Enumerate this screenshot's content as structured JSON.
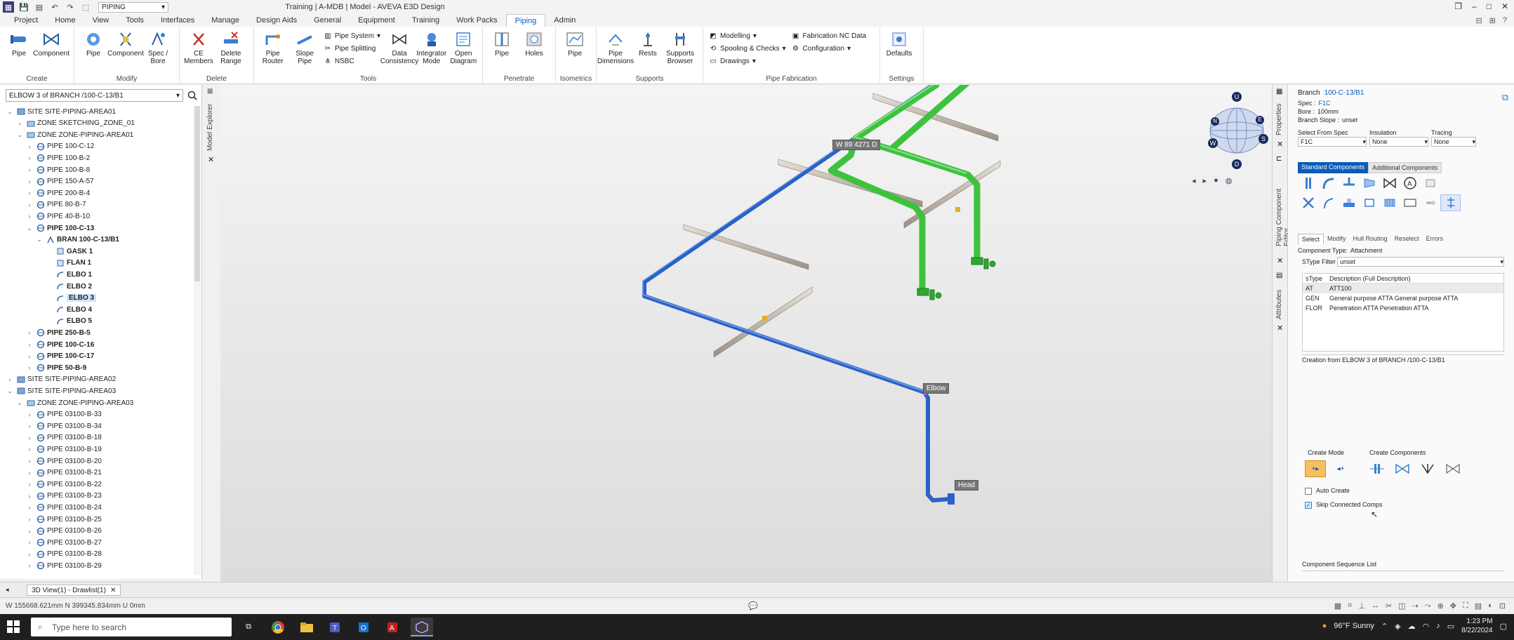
{
  "titlebar": {
    "quick_select": "PIPING",
    "window_title": "Training | A-MDB | Model - AVEVA E3D Design"
  },
  "menu": {
    "tabs": [
      "Project",
      "Home",
      "View",
      "Tools",
      "Interfaces",
      "Manage",
      "Design Aids",
      "General",
      "Equipment",
      "Training",
      "Work Packs",
      "Piping",
      "Admin"
    ],
    "active": "Piping"
  },
  "ribbon": {
    "groups": [
      {
        "label": "Create",
        "buttons": [
          "Pipe",
          "Component"
        ]
      },
      {
        "label": "Modify",
        "buttons": [
          "Pipe",
          "Component",
          "Spec / Bore"
        ]
      },
      {
        "label": "Delete",
        "buttons": [
          "CE Members",
          "Delete Range"
        ]
      },
      {
        "label": "Tools",
        "buttons": [
          "Pipe Router",
          "Slope Pipe",
          "Data Consistency",
          "Integrator Mode",
          "Open Diagram"
        ],
        "small": [
          "Pipe System",
          "Pipe Splitting",
          "NSBC"
        ]
      },
      {
        "label": "Penetrate",
        "buttons": [
          "Pipe",
          "Holes"
        ]
      },
      {
        "label": "Isometrics",
        "buttons": [
          "Pipe"
        ]
      },
      {
        "label": "Supports",
        "buttons": [
          "Pipe Dimensions",
          "Rests",
          "Supports Browser"
        ]
      },
      {
        "label": "Pipe Fabrication",
        "small": [
          "Modelling",
          "Spooling & Checks",
          "Drawings",
          "Fabrication NC Data",
          "Configuration"
        ]
      },
      {
        "label": "Settings",
        "buttons": [
          "Defaults"
        ]
      }
    ]
  },
  "explorer": {
    "side_tab": "Model Explorer",
    "search_value": "ELBOW 3 of BRANCH /100-C-13/B1",
    "tree": [
      {
        "label": "SITE SITE-PIPING-AREA01",
        "level": 1,
        "exp": "⌄",
        "kind": "site"
      },
      {
        "label": "ZONE SKETCHING_ZONE_01",
        "level": 2,
        "exp": "›",
        "kind": "zone"
      },
      {
        "label": "ZONE ZONE-PIPING-AREA01",
        "level": 2,
        "exp": "⌄",
        "kind": "zone"
      },
      {
        "label": "PIPE 100-C-12",
        "level": 3,
        "exp": "›",
        "kind": "pipe"
      },
      {
        "label": "PIPE 100-B-2",
        "level": 3,
        "exp": "›",
        "kind": "pipe"
      },
      {
        "label": "PIPE 100-B-8",
        "level": 3,
        "exp": "›",
        "kind": "pipe"
      },
      {
        "label": "PIPE 150-A-57",
        "level": 3,
        "exp": "›",
        "kind": "pipe"
      },
      {
        "label": "PIPE 200-B-4",
        "level": 3,
        "exp": "›",
        "kind": "pipe"
      },
      {
        "label": "PIPE 80-B-7",
        "level": 3,
        "exp": "›",
        "kind": "pipe"
      },
      {
        "label": "PIPE 40-B-10",
        "level": 3,
        "exp": "›",
        "kind": "pipe"
      },
      {
        "label": "PIPE 100-C-13",
        "level": 3,
        "exp": "⌄",
        "kind": "pipe",
        "bold": true
      },
      {
        "label": "BRAN 100-C-13/B1",
        "level": 4,
        "exp": "⌄",
        "kind": "bran",
        "bold": true
      },
      {
        "label": "GASK 1",
        "level": 5,
        "exp": "",
        "kind": "comp",
        "bold": true
      },
      {
        "label": "FLAN 1",
        "level": 5,
        "exp": "",
        "kind": "comp",
        "bold": true
      },
      {
        "label": "ELBO 1",
        "level": 5,
        "exp": "",
        "kind": "elbo",
        "bold": true
      },
      {
        "label": "ELBO 2",
        "level": 5,
        "exp": "",
        "kind": "elbo",
        "bold": true
      },
      {
        "label": "ELBO 3",
        "level": 5,
        "exp": "",
        "kind": "elbo",
        "bold": true,
        "selected": true
      },
      {
        "label": "ELBO 4",
        "level": 5,
        "exp": "",
        "kind": "elbo",
        "bold": true
      },
      {
        "label": "ELBO 5",
        "level": 5,
        "exp": "",
        "kind": "elbo",
        "bold": true
      },
      {
        "label": "PIPE 250-B-5",
        "level": 3,
        "exp": "›",
        "kind": "pipe",
        "bold": true
      },
      {
        "label": "PIPE 100-C-16",
        "level": 3,
        "exp": "›",
        "kind": "pipe",
        "bold": true
      },
      {
        "label": "PIPE 100-C-17",
        "level": 3,
        "exp": "›",
        "kind": "pipe",
        "bold": true
      },
      {
        "label": "PIPE 50-B-9",
        "level": 3,
        "exp": "›",
        "kind": "pipe",
        "bold": true
      },
      {
        "label": "SITE SITE-PIPING-AREA02",
        "level": 1,
        "exp": "›",
        "kind": "site"
      },
      {
        "label": "SITE SITE-PIPING-AREA03",
        "level": 1,
        "exp": "⌄",
        "kind": "site"
      },
      {
        "label": "ZONE ZONE-PIPING-AREA03",
        "level": 2,
        "exp": "⌄",
        "kind": "zone"
      },
      {
        "label": "PIPE 03100-B-33",
        "level": 3,
        "exp": "›",
        "kind": "pipe"
      },
      {
        "label": "PIPE 03100-B-34",
        "level": 3,
        "exp": "›",
        "kind": "pipe"
      },
      {
        "label": "PIPE 03100-B-18",
        "level": 3,
        "exp": "›",
        "kind": "pipe"
      },
      {
        "label": "PIPE 03100-B-19",
        "level": 3,
        "exp": "›",
        "kind": "pipe"
      },
      {
        "label": "PIPE 03100-B-20",
        "level": 3,
        "exp": "›",
        "kind": "pipe"
      },
      {
        "label": "PIPE 03100-B-21",
        "level": 3,
        "exp": "›",
        "kind": "pipe"
      },
      {
        "label": "PIPE 03100-B-22",
        "level": 3,
        "exp": "›",
        "kind": "pipe"
      },
      {
        "label": "PIPE 03100-B-23",
        "level": 3,
        "exp": "›",
        "kind": "pipe"
      },
      {
        "label": "PIPE 03100-B-24",
        "level": 3,
        "exp": "›",
        "kind": "pipe"
      },
      {
        "label": "PIPE 03100-B-25",
        "level": 3,
        "exp": "›",
        "kind": "pipe"
      },
      {
        "label": "PIPE 03100-B-26",
        "level": 3,
        "exp": "›",
        "kind": "pipe"
      },
      {
        "label": "PIPE 03100-B-27",
        "level": 3,
        "exp": "›",
        "kind": "pipe"
      },
      {
        "label": "PIPE 03100-B-28",
        "level": 3,
        "exp": "›",
        "kind": "pipe"
      },
      {
        "label": "PIPE 03100-B-29",
        "level": 3,
        "exp": "›",
        "kind": "pipe"
      }
    ]
  },
  "viewport": {
    "labels": {
      "weld": "W 89 4271 D",
      "elbow": "Elbow",
      "head": "Head"
    },
    "nav_cube": {
      "top": "U",
      "bottom": "D",
      "west": "W",
      "east": "E",
      "north": "N",
      "south": "S"
    }
  },
  "right_strip": {
    "tabs": [
      "Properties",
      "Piping Component Editor",
      "Attributes"
    ]
  },
  "panel": {
    "branch_label": "Branch",
    "branch_value": "100-C-13/B1",
    "spec_label": "Spec :",
    "spec_value": "F1C",
    "bore_label": "Bore :",
    "bore_value": "100mm",
    "slope_label": "Branch Slope :",
    "slope_value": "unset",
    "select_spec_label": "Select From Spec",
    "select_spec_value": "F1C",
    "insulation_label": "Insulation",
    "insulation_value": "None",
    "tracing_label": "Tracing",
    "tracing_value": "None",
    "comp_tabs": [
      "Standard Components",
      "Additional Components"
    ],
    "action_tabs": [
      "Select",
      "Modify",
      "Hull Routing",
      "Reselect",
      "Errors"
    ],
    "component_type_label": "Component Type:",
    "component_type_value": "Attachment",
    "stype_filter_label": "SType Filter",
    "stype_filter_value": "unset",
    "table_headers": [
      "sType",
      "Description (Full Description)"
    ],
    "table_rows": [
      {
        "stype": "AT",
        "desc": "ATT100"
      },
      {
        "stype": "GEN",
        "desc": "General purpose ATTA General purpose ATTA"
      },
      {
        "stype": "FLOR",
        "desc": "Penetration ATTA Penetration ATTA"
      }
    ],
    "creation_from": "Creation from ELBOW 3 of BRANCH /100-C-13/B1",
    "create_mode_label": "Create Mode",
    "create_components_label": "Create Components",
    "auto_create_label": "Auto Create",
    "auto_create_checked": false,
    "skip_connected_label": "Skip Connected Comps",
    "skip_connected_checked": true,
    "sequence_label": "Component Sequence List"
  },
  "doc_tab": "3D View(1) - Drawlist(1)",
  "status": "W 155668.621mm N 399345.834mm U 0mm",
  "taskbar": {
    "search_placeholder": "Type here to search",
    "weather": "96°F Sunny",
    "time": "1:23 PM",
    "date": "8/22/2024"
  },
  "colors": {
    "pipe_blue": "#2a62c9",
    "pipe_green": "#3ec23e",
    "steel": "#c8c0b8",
    "accent": "#0a5cb8"
  }
}
